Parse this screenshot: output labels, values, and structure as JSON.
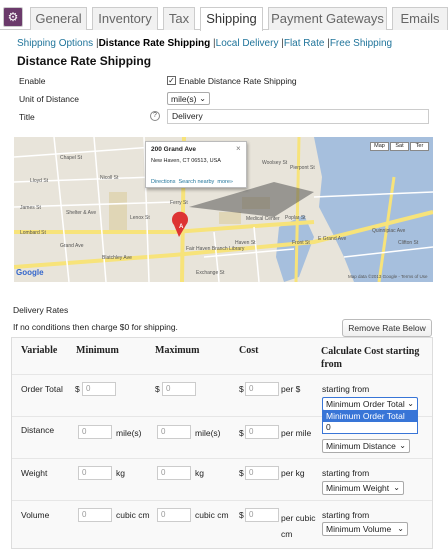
{
  "tabs": [
    "General",
    "Inventory",
    "Tax",
    "Shipping",
    "Payment Gateways",
    "Emails"
  ],
  "active_tab": "Shipping",
  "subnav": {
    "items": [
      "Shipping Options",
      "Distance Rate Shipping",
      "Local Delivery",
      "Flat Rate",
      "Free Shipping"
    ],
    "separator": "|"
  },
  "page_title": "Distance Rate Shipping",
  "form": {
    "enable_label": "Enable",
    "enable_checkbox_text": "Enable Distance Rate Shipping",
    "unit_label": "Unit of Distance",
    "unit_value": "mile(s)",
    "title_label": "Title",
    "title_value": "Delivery",
    "help": "?"
  },
  "map": {
    "buttons": [
      "Map",
      "Sat",
      "Ter"
    ],
    "popup_title": "200 Grand Ave",
    "popup_address": "New Haven, CT 06513, USA",
    "popup_links": [
      "Directions",
      "Search nearby",
      "more»"
    ],
    "popup_close": "×",
    "marker": "A",
    "logo": "Google",
    "credits": "Map data ©2013 Google - Terms of Use",
    "labels": [
      "Fair Haven Branch Library",
      "Exchange St",
      "Grand Ave",
      "E Grand Ave",
      "Blatchley Ave",
      "James St",
      "Ferry St",
      "Haven St",
      "Front St",
      "Clifton St",
      "Woolsey St",
      "Poplar St",
      "Pierpont St",
      "Lloyd St",
      "Shelter & Ave",
      "Lombard St",
      "Medical Center",
      "Quinnipiac Ave",
      "Chapel St",
      "Lenox St",
      "Nicoll St"
    ]
  },
  "rates": {
    "heading": "Delivery Rates",
    "note": "If no conditions then charge $0 for shipping.",
    "remove_button": "Remove Rate Below",
    "columns": [
      "Variable",
      "Minimum",
      "Maximum",
      "Cost",
      "Calculate Cost starting from"
    ],
    "rows": [
      {
        "variable": "Order Total",
        "min_prefix": "$",
        "min_placeholder": "0",
        "min_suffix": "",
        "max_prefix": "$",
        "max_placeholder": "0",
        "max_suffix": "",
        "cost_prefix": "$",
        "cost_placeholder": "0",
        "cost_suffix": "per $",
        "start_label": "starting from",
        "start_value": "Minimum Order Total"
      },
      {
        "variable": "Distance",
        "min_prefix": "",
        "min_placeholder": "0",
        "min_suffix": "mile(s)",
        "max_prefix": "",
        "max_placeholder": "0",
        "max_suffix": "mile(s)",
        "cost_prefix": "$",
        "cost_placeholder": "0",
        "cost_suffix": "per mile",
        "start_label": "",
        "start_value": "Minimum Distance"
      },
      {
        "variable": "Weight",
        "min_prefix": "",
        "min_placeholder": "0",
        "min_suffix": "kg",
        "max_prefix": "",
        "max_placeholder": "0",
        "max_suffix": "kg",
        "cost_prefix": "$",
        "cost_placeholder": "0",
        "cost_suffix": "per kg",
        "start_label": "starting from",
        "start_value": "Minimum Weight"
      },
      {
        "variable": "Volume",
        "min_prefix": "",
        "min_placeholder": "0",
        "min_suffix": "cubic cm",
        "max_prefix": "",
        "max_placeholder": "0",
        "max_suffix": "cubic cm",
        "cost_prefix": "$",
        "cost_placeholder": "0",
        "cost_suffix": "per cubic cm",
        "start_label": "starting from",
        "start_value": "Minimum Volume"
      }
    ],
    "open_dropdown_options": [
      "Minimum Order Total",
      "0"
    ],
    "open_dropdown_highlighted": "Minimum Order Total"
  },
  "colors": {
    "link": "#21759b",
    "gear": "#6b3a6b",
    "highlight": "#3875d7",
    "water": "#a6bfdd",
    "road": "#f7e37a"
  }
}
